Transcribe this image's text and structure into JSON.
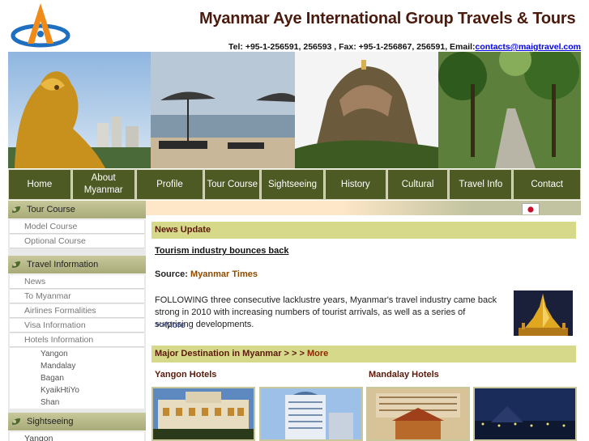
{
  "header": {
    "title": "Myanmar Aye International Group Travels & Tours",
    "contact_text": "Tel: +95-1-256591, 256593 , Fax: +95-1-256867, 256591, Email:",
    "email": "contacts@maigtravel.com"
  },
  "nav": [
    {
      "label": "Home"
    },
    {
      "label": "About Myanmar"
    },
    {
      "label": "Profile"
    },
    {
      "label": "Tour Course"
    },
    {
      "label": "Sightseeing"
    },
    {
      "label": "History"
    },
    {
      "label": "Cultural"
    },
    {
      "label": "Travel Info"
    },
    {
      "label": "Contact"
    }
  ],
  "sidebar": {
    "tour_course": {
      "heading": "Tour Course",
      "items": [
        "Model Course",
        "Optional Course"
      ]
    },
    "travel_info": {
      "heading": "Travel Information",
      "items": [
        "News",
        "To Myanmar",
        "Airlines Formalities",
        "Visa Information",
        "Hotels Information"
      ],
      "sub_items": [
        "Yangon",
        "Mandalay",
        "Bagan",
        "KyaikHtiYo",
        "Shan"
      ]
    },
    "sightseeing": {
      "heading": "Sightseeing",
      "items": [
        "Yangon"
      ]
    }
  },
  "main": {
    "news_bar": "News Update",
    "news_title": "Tourism industry bounces back",
    "source_label": "Source:",
    "source_value": "Myanmar Times",
    "news_body": "FOLLOWING three consecutive lacklustre years, Myanmar's travel industry came back strong in 2010 with increasing numbers of tourist arrivals, as well as a series of surprising developments.",
    "news_more": ">>More",
    "dest_bar": "Major Destination in Myanmar > > > ",
    "dest_more": "More",
    "yangon_hotels": "Yangon Hotels",
    "mandalay_hotels": "Mandalay Hotels"
  },
  "colors": {
    "nav_bg": "#4d5a24",
    "title_color": "#4a1a0c",
    "bar_bg": "#d6d88a"
  }
}
